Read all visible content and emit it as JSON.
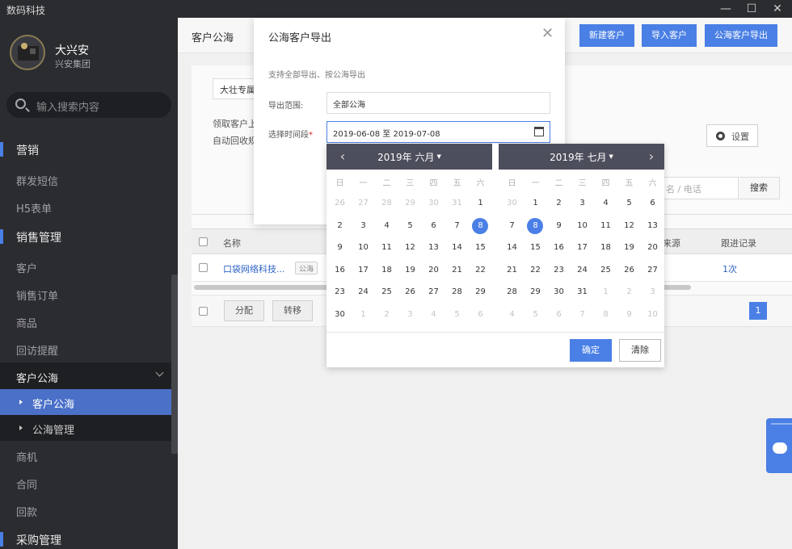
{
  "app": {
    "title": "数码科技"
  },
  "window": {
    "minimize": "—",
    "maximize": "☐",
    "close": "✕"
  },
  "user": {
    "name": "大兴安",
    "org": "兴安集团"
  },
  "search": {
    "placeholder": "输入搜索内容"
  },
  "sidebar": {
    "marketing": "营销",
    "sms": "群发短信",
    "h5": "H5表单",
    "sales": "销售管理",
    "customer": "客户",
    "order": "销售订单",
    "product": "商品",
    "followup": "回访提醒",
    "pool": "客户公海",
    "pool_sub": "客户公海",
    "pool_manage": "公海管理",
    "opportunity": "商机",
    "contract": "合同",
    "payment": "回款",
    "purchase": "采购管理"
  },
  "header": {
    "title": "客户公海",
    "new_customer": "新建客户",
    "import_customer": "导入客户",
    "export_pool": "公海客户导出"
  },
  "content": {
    "select_value": "大壮专属",
    "rule1": "领取客户上",
    "rule2": "自动回收规",
    "settings": "设置",
    "name_placeholder": "名 / 电话",
    "search_btn": "搜索"
  },
  "table": {
    "col_name": "名称",
    "col_source": "来源",
    "col_followup": "跟进记录",
    "row_name": "口袋网络科技...",
    "row_tag": "公海",
    "row_count": "1次",
    "btn_assign": "分配",
    "btn_transfer": "转移",
    "page": "1"
  },
  "modal": {
    "title": "公海客户导出",
    "close": "✕",
    "desc": "支持全部导出、按公海导出",
    "range_label": "导出范围:",
    "range_value": "全部公海",
    "period_label": "选择时间段",
    "period_required": "*",
    "period_value": "2019-06-08 至 2019-07-08"
  },
  "picker": {
    "left": {
      "year_month": "2019年 六月",
      "weekdays": [
        "日",
        "一",
        "二",
        "三",
        "四",
        "五",
        "六"
      ],
      "days": [
        [
          "26",
          "27",
          "28",
          "29",
          "30",
          "31",
          "1"
        ],
        [
          "2",
          "3",
          "4",
          "5",
          "6",
          "7",
          "8"
        ],
        [
          "9",
          "10",
          "11",
          "12",
          "13",
          "14",
          "15"
        ],
        [
          "16",
          "17",
          "18",
          "19",
          "20",
          "21",
          "22"
        ],
        [
          "23",
          "24",
          "25",
          "26",
          "27",
          "28",
          "29"
        ],
        [
          "30",
          "1",
          "2",
          "3",
          "4",
          "5",
          "6"
        ]
      ],
      "muted": [
        [
          0,
          0
        ],
        [
          0,
          1
        ],
        [
          0,
          2
        ],
        [
          0,
          3
        ],
        [
          0,
          4
        ],
        [
          0,
          5
        ],
        [
          5,
          1
        ],
        [
          5,
          2
        ],
        [
          5,
          3
        ],
        [
          5,
          4
        ],
        [
          5,
          5
        ],
        [
          5,
          6
        ]
      ],
      "selected": [
        1,
        6
      ]
    },
    "right": {
      "year_month": "2019年 七月",
      "weekdays": [
        "日",
        "一",
        "二",
        "三",
        "四",
        "五",
        "六"
      ],
      "days": [
        [
          "30",
          "1",
          "2",
          "3",
          "4",
          "5",
          "6"
        ],
        [
          "7",
          "8",
          "9",
          "10",
          "11",
          "12",
          "13"
        ],
        [
          "14",
          "15",
          "16",
          "17",
          "18",
          "19",
          "20"
        ],
        [
          "21",
          "22",
          "23",
          "24",
          "25",
          "26",
          "27"
        ],
        [
          "28",
          "29",
          "30",
          "31",
          "1",
          "2",
          "3"
        ],
        [
          "4",
          "5",
          "6",
          "7",
          "8",
          "9",
          "10"
        ]
      ],
      "muted": [
        [
          0,
          0
        ],
        [
          4,
          4
        ],
        [
          4,
          5
        ],
        [
          4,
          6
        ],
        [
          5,
          0
        ],
        [
          5,
          1
        ],
        [
          5,
          2
        ],
        [
          5,
          3
        ],
        [
          5,
          4
        ],
        [
          5,
          5
        ],
        [
          5,
          6
        ]
      ],
      "selected": [
        1,
        1
      ]
    },
    "prev": "‹",
    "next": "›",
    "ok": "确定",
    "clear": "清除"
  },
  "colors": {
    "accent": "#4a7fe5",
    "sidebar": "#2b2c30",
    "link": "#2d63c4"
  }
}
